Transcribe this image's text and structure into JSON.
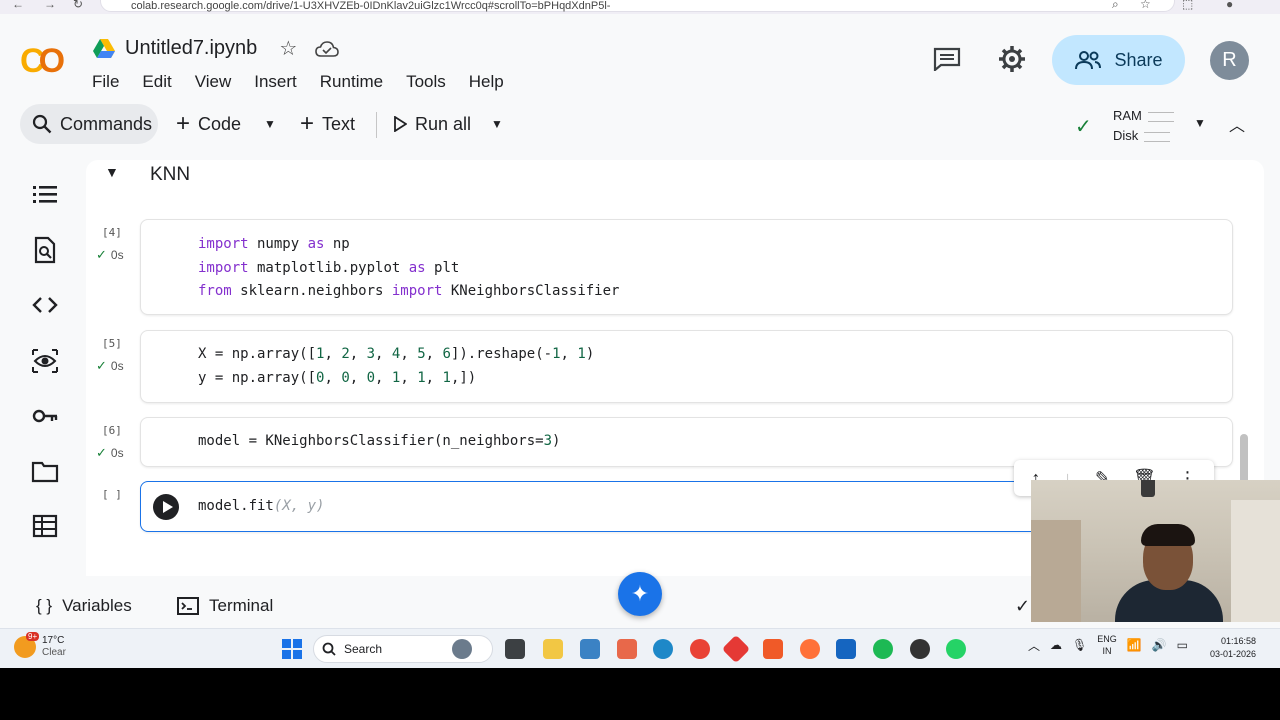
{
  "browser": {
    "url": "colab.research.google.com/drive/1-U3XHVZEb-0IDnKlav2uiGlzc1Wrcc0q#scrollTo=bPHqdXdnP5l-"
  },
  "header": {
    "notebook_title": "Untitled7.ipynb",
    "menu": [
      "File",
      "Edit",
      "View",
      "Insert",
      "Runtime",
      "Tools",
      "Help"
    ],
    "share_label": "Share",
    "avatar_initial": "R"
  },
  "toolbar": {
    "commands_label": "Commands",
    "code_label": "Code",
    "text_label": "Text",
    "run_all_label": "Run all",
    "ram_label": "RAM",
    "disk_label": "Disk"
  },
  "section": {
    "title": "KNN"
  },
  "cells": [
    {
      "exec": "[4]",
      "time": "0s"
    },
    {
      "exec": "[5]",
      "time": "0s"
    },
    {
      "exec": "[6]",
      "time": "0s"
    },
    {
      "exec": "[ ]"
    }
  ],
  "bottom": {
    "variables_label": "Variables",
    "terminal_label": "Terminal"
  },
  "taskbar": {
    "weather_badge": "9+",
    "temperature": "17°C",
    "condition": "Clear",
    "search_placeholder": "Search",
    "lang": "ENG",
    "region": "IN",
    "time": "01:16:58",
    "date": "03-01-2026"
  },
  "colors": {
    "accent": "#1a73e8",
    "share_bg": "#c2e7ff",
    "logo_orange": "#f9ab00",
    "ok_green": "#188038"
  }
}
